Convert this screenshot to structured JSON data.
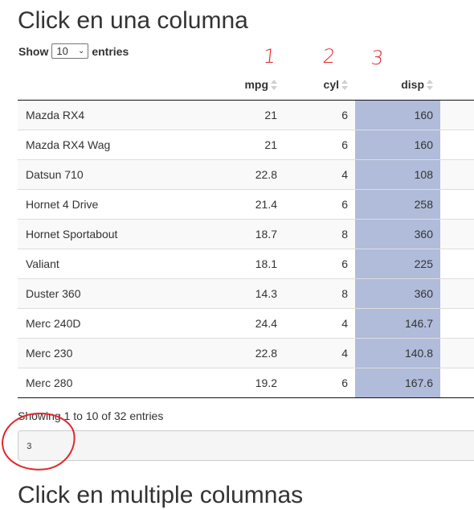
{
  "page": {
    "title": "Click en una columna",
    "next_heading": "Click en multiple columnas"
  },
  "length_control": {
    "label_before": "Show",
    "selected": "10",
    "label_after": "entries"
  },
  "annotations": {
    "col_numbers": [
      "1",
      "2",
      "3"
    ],
    "color": "#e3262c"
  },
  "table": {
    "columns": [
      {
        "label": "",
        "sortable": false
      },
      {
        "label": "mpg",
        "sortable": true
      },
      {
        "label": "cyl",
        "sortable": true
      },
      {
        "label": "disp",
        "sortable": true
      }
    ],
    "selected_column": 3,
    "selected_color": "#b0bcd9",
    "rows": [
      {
        "name": "Mazda RX4",
        "mpg": "21",
        "cyl": "6",
        "disp": "160"
      },
      {
        "name": "Mazda RX4 Wag",
        "mpg": "21",
        "cyl": "6",
        "disp": "160"
      },
      {
        "name": "Datsun 710",
        "mpg": "22.8",
        "cyl": "4",
        "disp": "108"
      },
      {
        "name": "Hornet 4 Drive",
        "mpg": "21.4",
        "cyl": "6",
        "disp": "258"
      },
      {
        "name": "Hornet Sportabout",
        "mpg": "18.7",
        "cyl": "8",
        "disp": "360"
      },
      {
        "name": "Valiant",
        "mpg": "18.1",
        "cyl": "6",
        "disp": "225"
      },
      {
        "name": "Duster 360",
        "mpg": "14.3",
        "cyl": "8",
        "disp": "360"
      },
      {
        "name": "Merc 240D",
        "mpg": "24.4",
        "cyl": "4",
        "disp": "146.7"
      },
      {
        "name": "Merc 230",
        "mpg": "22.8",
        "cyl": "4",
        "disp": "140.8"
      },
      {
        "name": "Merc 280",
        "mpg": "19.2",
        "cyl": "6",
        "disp": "167.6"
      }
    ]
  },
  "info": "Showing 1 to 10 of 32 entries",
  "output": "3"
}
